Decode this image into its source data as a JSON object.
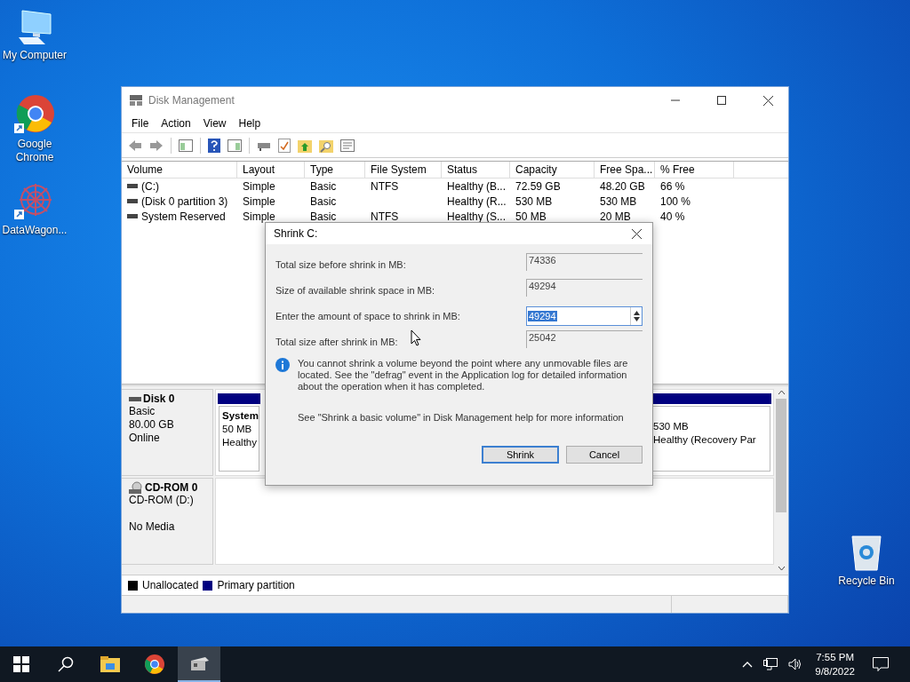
{
  "desktop_icons": [
    {
      "label": "My Computer",
      "kind": "computer"
    },
    {
      "label": "Google\nChrome",
      "kind": "chrome"
    },
    {
      "label": "DataWagon...",
      "kind": "datawagon"
    },
    {
      "label": "Recycle Bin",
      "kind": "recycle"
    }
  ],
  "window": {
    "title": "Disk Management"
  },
  "menu": [
    "File",
    "Action",
    "View",
    "Help"
  ],
  "table": {
    "columns": [
      "Volume",
      "Layout",
      "Type",
      "File System",
      "Status",
      "Capacity",
      "Free Spa...",
      "% Free"
    ],
    "rows": [
      [
        "(C:)",
        "Simple",
        "Basic",
        "NTFS",
        "Healthy (B...",
        "72.59 GB",
        "48.20 GB",
        "66 %"
      ],
      [
        "(Disk 0 partition 3)",
        "Simple",
        "Basic",
        "",
        "Healthy (R...",
        "530 MB",
        "530 MB",
        "100 %"
      ],
      [
        "System Reserved",
        "Simple",
        "Basic",
        "NTFS",
        "Healthy (S...",
        "50 MB",
        "20 MB",
        "40 %"
      ]
    ]
  },
  "disks": [
    {
      "name": "Disk 0",
      "kind": "disk",
      "lines": [
        "Basic",
        "80.00 GB",
        "Online"
      ],
      "partitions": [
        {
          "color": "#000080",
          "title": "System",
          "lines": [
            "50 MB",
            "Healthy"
          ]
        },
        {
          "color": "#000080",
          "lines": [
            "530 MB",
            "Healthy (Recovery Par"
          ]
        }
      ]
    },
    {
      "name": "CD-ROM 0",
      "kind": "cdrom",
      "lines": [
        "CD-ROM (D:)",
        "No Media"
      ]
    }
  ],
  "legend": [
    {
      "label": "Unallocated",
      "color": "#000000"
    },
    {
      "label": "Primary partition",
      "color": "#000080"
    }
  ],
  "dialog": {
    "title": "Shrink C:",
    "fields": [
      {
        "label": "Total size before shrink in MB:",
        "value": "74336",
        "kind": "readonly"
      },
      {
        "label": "Size of available shrink space in MB:",
        "value": "49294",
        "kind": "readonly"
      },
      {
        "label": "Enter the amount of space to shrink in MB:",
        "value": "49294",
        "kind": "spin",
        "selected": true
      },
      {
        "label": "Total size after shrink in MB:",
        "value": "25042",
        "kind": "readonly"
      }
    ],
    "info": "You cannot shrink a volume beyond the point where any unmovable files are located. See the \"defrag\" event in the Application log for detailed information about the operation when it has completed.",
    "help": "See \"Shrink a basic volume\" in Disk Management help for more information",
    "buttons": [
      {
        "label": "Shrink",
        "default": true
      },
      {
        "label": "Cancel",
        "default": false
      }
    ]
  },
  "taskbar": {
    "apps": [
      {
        "kind": "explorer",
        "active": false
      },
      {
        "kind": "chrome",
        "active": false
      },
      {
        "kind": "diskmgmt",
        "active": true
      }
    ],
    "time": "7:55 PM",
    "date": "9/8/2022"
  }
}
